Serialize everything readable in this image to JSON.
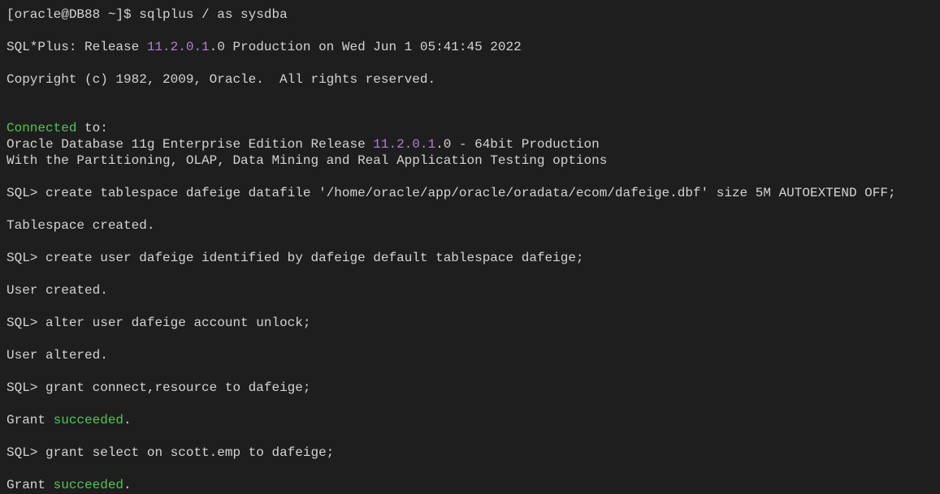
{
  "line1": {
    "prompt": "[oracle@DB88 ~]$ ",
    "command": "sqlplus / as sysdba"
  },
  "line2": {
    "prefix": "SQL*Plus: Release ",
    "version": "11.2.0.1",
    "suffix": ".0 Production on Wed Jun 1 05:41:45 2022"
  },
  "line3": "Copyright (c) 1982, 2009, Oracle.  All rights reserved.",
  "line4": {
    "connected": "Connected",
    "to": " to:"
  },
  "line5": {
    "prefix": "Oracle Database 11g Enterprise Edition Release ",
    "version": "11.2.0.1",
    "suffix": ".0 - 64bit Production"
  },
  "line6": "With the Partitioning, OLAP, Data Mining and Real Application Testing options",
  "line7": {
    "prompt": "SQL> ",
    "command": "create tablespace dafeige datafile '/home/oracle/app/oracle/oradata/ecom/dafeige.dbf' size 5M AUTOEXTEND OFF;"
  },
  "line8": "Tablespace created.",
  "line9": {
    "prompt": "SQL> ",
    "command": "create user dafeige identified by dafeige default tablespace dafeige;"
  },
  "line10": "User created.",
  "line11": {
    "prompt": "SQL> ",
    "command": "alter user dafeige account unlock;"
  },
  "line12": "User altered.",
  "line13": {
    "prompt": "SQL> ",
    "command": "grant connect,resource to dafeige;"
  },
  "line14": {
    "prefix": "Grant ",
    "succeeded": "succeeded",
    "suffix": "."
  },
  "line15": {
    "prompt": "SQL> ",
    "command": "grant select on scott.emp to dafeige;"
  },
  "line16": {
    "prefix": "Grant ",
    "succeeded": "succeeded",
    "suffix": "."
  }
}
